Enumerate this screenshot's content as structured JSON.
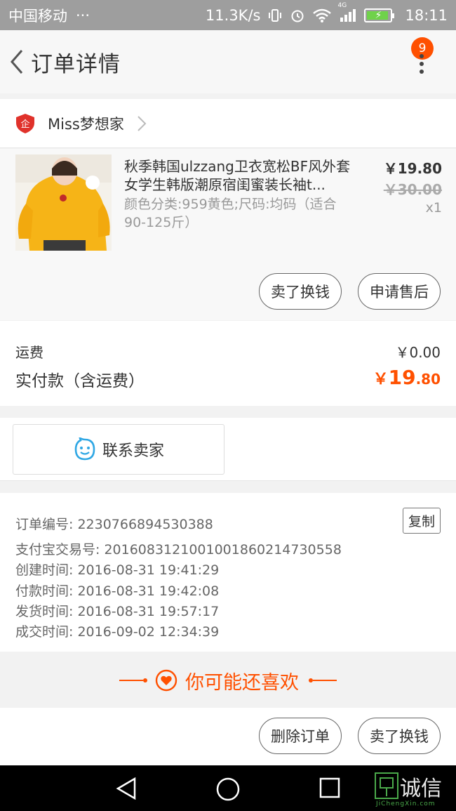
{
  "status_bar": {
    "carrier": "中国移动",
    "dots": "···",
    "speed": "11.3K/s",
    "network": "4G",
    "time": "18:11"
  },
  "header": {
    "title": "订单详情",
    "badge_count": "9"
  },
  "shop": {
    "name": "Miss梦想家",
    "icon_text": "企"
  },
  "item": {
    "title": "秋季韩国ulzzang卫衣宽松BF风外套女学生韩版潮原宿闺蜜装长袖t...",
    "sku": "颜色分类:959黄色;尺码:均码（适合90-125斤）",
    "price": "￥19.80",
    "original_price": "￥30.00",
    "quantity": "x1",
    "buttons": {
      "sell": "卖了换钱",
      "after_sale": "申请售后"
    }
  },
  "cost": {
    "shipping_label": "运费",
    "shipping_value": "￥0.00",
    "paid_label": "实付款（含运费）",
    "paid_currency": "￥",
    "paid_integer": "19",
    "paid_decimal": ".80"
  },
  "contact": {
    "label": "联系卖家"
  },
  "order_info": {
    "order_no": "订单编号: 2230766894530388",
    "copy_label": "复制",
    "alipay_no": "支付宝交易号: 2016083121001001860214730558",
    "created": "创建时间: 2016-08-31 19:41:29",
    "paid": "付款时间: 2016-08-31 19:42:08",
    "shipped": "发货时间: 2016-08-31 19:57:17",
    "completed": "成交时间: 2016-09-02 12:34:39"
  },
  "guess": {
    "label": "你可能还喜欢"
  },
  "actions": {
    "delete": "删除订单",
    "sell": "卖了换钱"
  },
  "watermark": {
    "text": "诚信",
    "sub": "JiChengXin.com"
  },
  "colors": {
    "accent": "#ff5000",
    "status_bar": "#9e9e9e",
    "contact_icon": "#2fa7e4"
  }
}
